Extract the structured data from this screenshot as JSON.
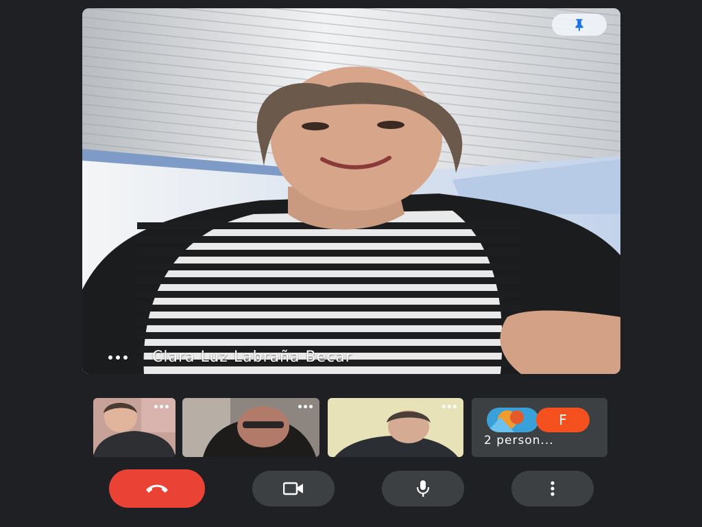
{
  "main_tile": {
    "participant_name": "Clara Luz Labraña Becar",
    "more_options_icon": "more-horizontal-icon",
    "pin_icon": "pin-icon"
  },
  "thumbnails": [
    {
      "id": "participant-1",
      "more_icon": "more-horizontal-icon"
    },
    {
      "id": "participant-2",
      "more_icon": "more-horizontal-icon"
    },
    {
      "id": "participant-3",
      "more_icon": "more-horizontal-icon"
    }
  ],
  "people_tile": {
    "avatar_letter": "F",
    "label": "2 person..."
  },
  "controls": {
    "end_call_icon": "hang-up-icon",
    "camera_icon": "video-camera-icon",
    "mic_icon": "microphone-icon",
    "more_icon": "more-vertical-icon"
  },
  "colors": {
    "background": "#1f2023",
    "control_bg": "#3c4043",
    "end_call": "#ea4335",
    "avatar_orange": "#f4511e",
    "pin_icon": "#1a73e8"
  }
}
